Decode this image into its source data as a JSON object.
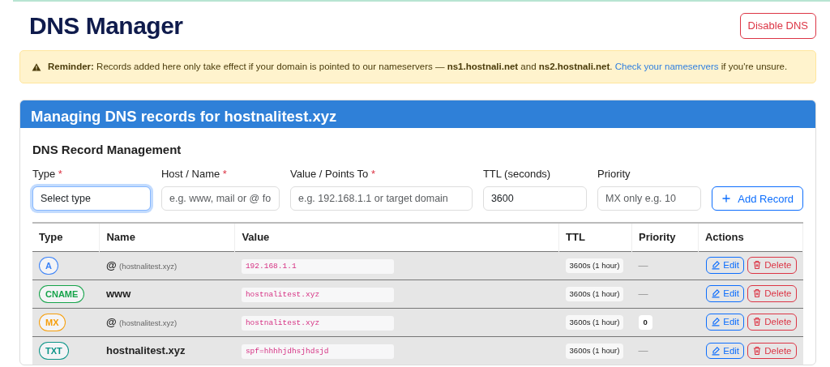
{
  "page": {
    "title": "DNS Manager",
    "disable_button": "Disable DNS"
  },
  "alert": {
    "text": "**Reminder:** Records added here only take effect if your domain is pointed to our nameservers — **ns1.hostnali.net** and **ns2.hostnali.net**.",
    "link": "Check your nameservers",
    "after": "if you're unsure."
  },
  "card": {
    "title": "Managing DNS records for hostnalitest.xyz",
    "section_title": "DNS Record Management",
    "form": [
      {
        "label": "Type",
        "required_mark": "*",
        "kind": "select",
        "value": "Select type",
        "focused": true
      },
      {
        "label": "Host / Name",
        "required_mark": "*",
        "kind": "input",
        "placeholder": "e.g. www, mail or @ fo"
      },
      {
        "label": "Value / Points To",
        "required_mark": "*",
        "kind": "input",
        "placeholder": "e.g. 192.168.1.1 or target domain"
      },
      {
        "label": "TTL (seconds)",
        "kind": "input",
        "value": "3600"
      },
      {
        "label": "Priority",
        "kind": "input",
        "placeholder": "MX only e.g. 10"
      }
    ],
    "add_button": "Add Record",
    "table": {
      "columns": [
        "Type",
        "Name",
        "Value",
        "TTL",
        "Priority",
        "Actions"
      ],
      "rows": [
        {
          "type": "A",
          "color": "#3b82f6",
          "name": "@",
          "name_note": "(hostnalitest.xyz)",
          "value": "192.168.1.1",
          "ttl": "3600s (1 hour)",
          "priority": {
            "kind": "dash",
            "text": "—"
          },
          "edit": "Edit",
          "delete": "Delete"
        },
        {
          "type": "CNAME",
          "color": "#16a34a",
          "name": "www",
          "value": "hostnalitest.xyz",
          "ttl": "3600s (1 hour)",
          "priority": {
            "kind": "dash",
            "text": "—"
          },
          "edit": "Edit",
          "delete": "Delete"
        },
        {
          "type": "MX",
          "color": "#f59e0b",
          "name": "@",
          "name_note": "(hostnalitest.xyz)",
          "value": "hostnalitest.xyz",
          "ttl": "3600s (1 hour)",
          "priority": {
            "kind": "badge",
            "text": "0"
          },
          "edit": "Edit",
          "delete": "Delete"
        },
        {
          "type": "TXT",
          "color": "#0d9488",
          "name": "hostnalitest.xyz",
          "value": "spf=hhhhjdhsjhdsjd",
          "ttl": "3600s (1 hour)",
          "priority": {
            "kind": "dash",
            "text": "—"
          },
          "edit": "Edit",
          "delete": "Delete"
        }
      ]
    }
  }
}
